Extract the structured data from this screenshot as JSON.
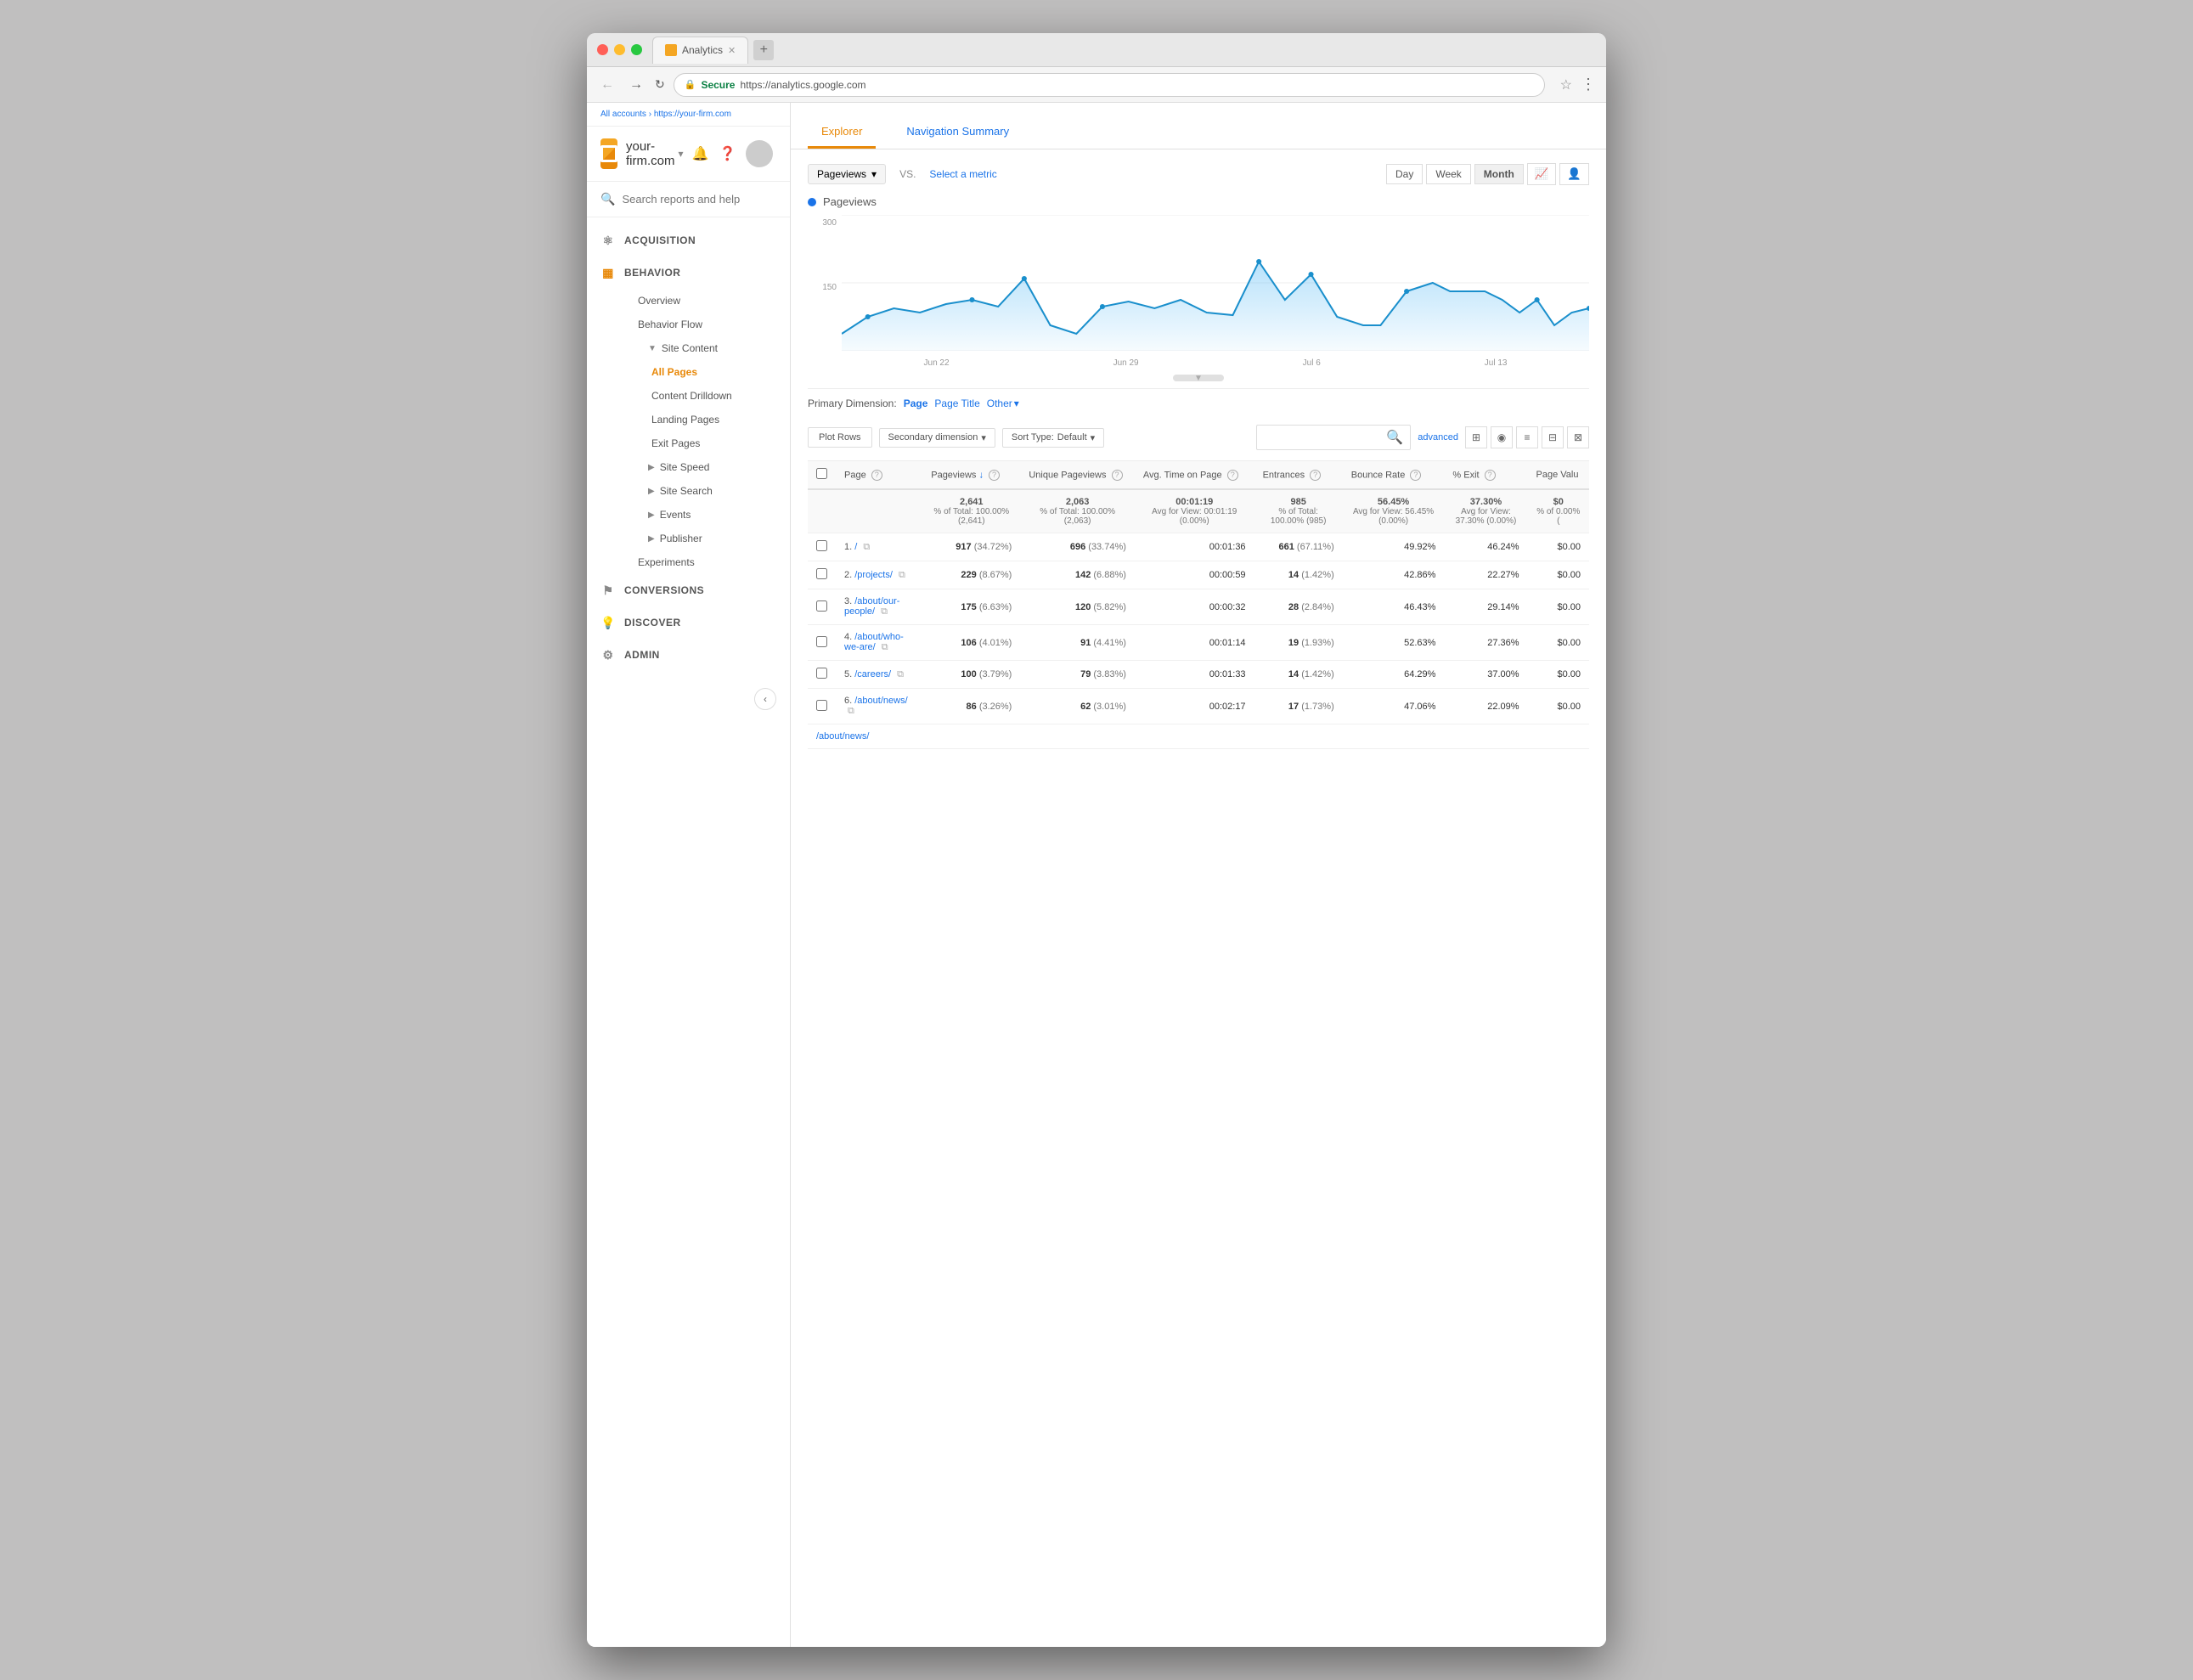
{
  "browser": {
    "title": "Analytics",
    "url_secure": "Secure",
    "url": "https://analytics.google.com",
    "tab_label": "Analytics"
  },
  "breadcrumb": {
    "all_accounts": "All accounts",
    "separator": ">",
    "site": "https://your-firm.com"
  },
  "site": {
    "name": "your-firm.com",
    "dropdown_arrow": "▾"
  },
  "search": {
    "placeholder": "Search reports and help"
  },
  "nav": {
    "acquisition": "ACQUISITION",
    "behavior": "BEHAVIOR",
    "behavior_sub": {
      "overview": "Overview",
      "behavior_flow": "Behavior Flow",
      "site_content_label": "Site Content",
      "all_pages": "All Pages",
      "content_drilldown": "Content Drilldown",
      "landing_pages": "Landing Pages",
      "exit_pages": "Exit Pages",
      "site_speed": "Site Speed",
      "site_search": "Site Search",
      "events": "Events",
      "publisher": "Publisher",
      "experiments": "Experiments"
    },
    "conversions": "CONVERSIONS",
    "discover": "DISCOVER",
    "admin": "ADMIN"
  },
  "tabs": {
    "explorer": "Explorer",
    "navigation_summary": "Navigation Summary"
  },
  "metric": {
    "pageviews_label": "Pageviews",
    "vs": "VS.",
    "select_metric": "Select a metric"
  },
  "time_controls": {
    "day": "Day",
    "week": "Week",
    "month": "Month"
  },
  "chart": {
    "y_labels": [
      "300",
      "150",
      ""
    ],
    "x_labels": [
      "Jun 22",
      "Jun 29",
      "Jul 6",
      "Jul 13"
    ],
    "pageviews_dot": "●"
  },
  "dimension": {
    "primary_label": "Primary Dimension:",
    "page": "Page",
    "page_title": "Page Title",
    "other": "Other"
  },
  "table_controls": {
    "plot_rows": "Plot Rows",
    "secondary_dimension": "Secondary dimension",
    "sort_type_label": "Sort Type:",
    "sort_default": "Default",
    "advanced": "advanced"
  },
  "table": {
    "headers": {
      "page": "Page",
      "pageviews": "Pageviews",
      "unique_pageviews": "Unique Pageviews",
      "avg_time_on_page": "Avg. Time on Page",
      "entrances": "Entrances",
      "bounce_rate": "Bounce Rate",
      "pct_exit": "% Exit",
      "page_value": "Page Valu"
    },
    "summary": {
      "pageviews": "2,641",
      "pageviews_pct": "% of Total: 100.00% (2,641)",
      "unique_pageviews": "2,063",
      "unique_pct": "% of Total: 100.00% (2,063)",
      "avg_time": "00:01:19",
      "avg_time_sub": "Avg for View: 00:01:19 (0.00%)",
      "entrances": "985",
      "entrances_pct": "% of Total: 100.00% (985)",
      "bounce_rate": "56.45%",
      "bounce_sub": "Avg for View: 56.45% (0.00%)",
      "pct_exit": "37.30%",
      "exit_sub": "Avg for View: 37.30% (0.00%)",
      "page_value": "$0",
      "page_value_sub": "% of 0.00% ("
    },
    "rows": [
      {
        "num": "1.",
        "page": "/",
        "pageviews": "917",
        "pv_pct": "(34.72%)",
        "unique": "696",
        "u_pct": "(33.74%)",
        "avg_time": "00:01:36",
        "entrances": "661",
        "ent_pct": "(67.11%)",
        "bounce": "49.92%",
        "exit": "46.24%",
        "value": "$0.00"
      },
      {
        "num": "2.",
        "page": "/projects/",
        "pageviews": "229",
        "pv_pct": "(8.67%)",
        "unique": "142",
        "u_pct": "(6.88%)",
        "avg_time": "00:00:59",
        "entrances": "14",
        "ent_pct": "(1.42%)",
        "bounce": "42.86%",
        "exit": "22.27%",
        "value": "$0.00"
      },
      {
        "num": "3.",
        "page": "/about/our-people/",
        "pageviews": "175",
        "pv_pct": "(6.63%)",
        "unique": "120",
        "u_pct": "(5.82%)",
        "avg_time": "00:00:32",
        "entrances": "28",
        "ent_pct": "(2.84%)",
        "bounce": "46.43%",
        "exit": "29.14%",
        "value": "$0.00"
      },
      {
        "num": "4.",
        "page": "/about/who-we-are/",
        "pageviews": "106",
        "pv_pct": "(4.01%)",
        "unique": "91",
        "u_pct": "(4.41%)",
        "avg_time": "00:01:14",
        "entrances": "19",
        "ent_pct": "(1.93%)",
        "bounce": "52.63%",
        "exit": "27.36%",
        "value": "$0.00"
      },
      {
        "num": "5.",
        "page": "/careers/",
        "pageviews": "100",
        "pv_pct": "(3.79%)",
        "unique": "79",
        "u_pct": "(3.83%)",
        "avg_time": "00:01:33",
        "entrances": "14",
        "ent_pct": "(1.42%)",
        "bounce": "64.29%",
        "exit": "37.00%",
        "value": "$0.00"
      },
      {
        "num": "6.",
        "page": "/about/news/",
        "pageviews": "86",
        "pv_pct": "(3.26%)",
        "unique": "62",
        "u_pct": "(3.01%)",
        "avg_time": "00:02:17",
        "entrances": "17",
        "ent_pct": "(1.73%)",
        "bounce": "47.06%",
        "exit": "22.09%",
        "value": "$0.00"
      }
    ],
    "last_row_page": "/about/news/"
  }
}
